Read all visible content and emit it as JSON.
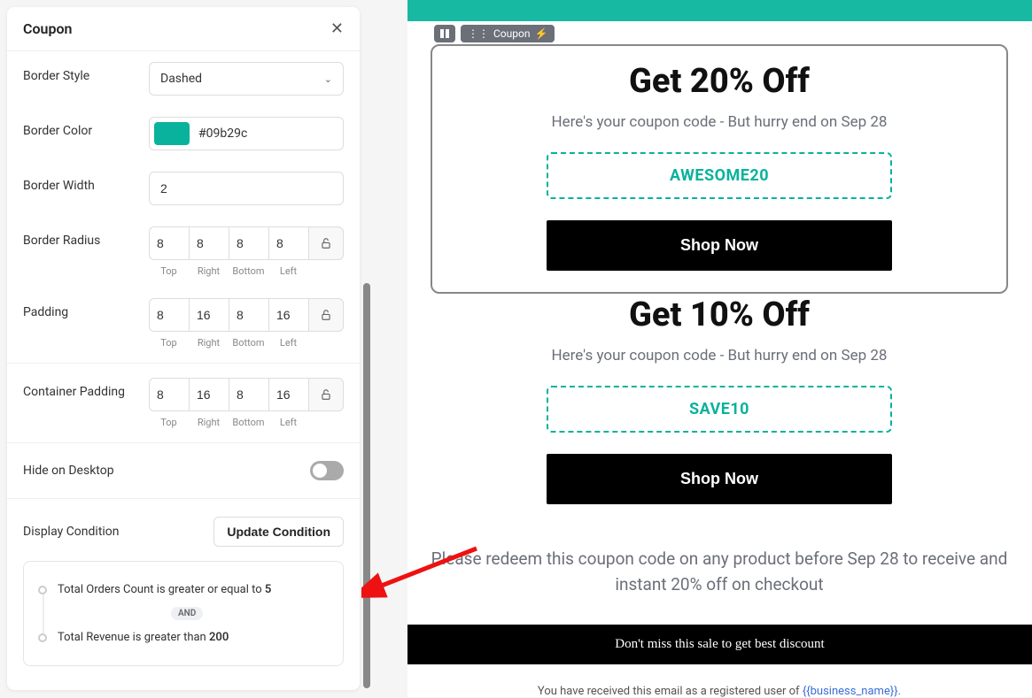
{
  "panel": {
    "title": "Coupon",
    "border_style": {
      "label": "Border Style",
      "value": "Dashed"
    },
    "border_color": {
      "label": "Border Color",
      "value": "#09b29c"
    },
    "border_width": {
      "label": "Border Width",
      "value": "2"
    },
    "border_radius": {
      "label": "Border Radius",
      "top": "8",
      "right": "8",
      "bottom": "8",
      "left": "8"
    },
    "padding": {
      "label": "Padding",
      "top": "8",
      "right": "16",
      "bottom": "8",
      "left": "16"
    },
    "container_padding": {
      "label": "Container Padding",
      "top": "8",
      "right": "16",
      "bottom": "8",
      "left": "16"
    },
    "sublabels": {
      "top": "Top",
      "right": "Right",
      "bottom": "Bottom",
      "left": "Left"
    },
    "hide_desktop": "Hide on Desktop",
    "display_condition": {
      "label": "Display Condition",
      "button": "Update Condition"
    },
    "conditions": {
      "line1_prefix": "Total Orders Count is greater or equal to ",
      "line1_value": "5",
      "join": "AND",
      "line2_prefix": "Total Revenue is greater than ",
      "line2_value": "200"
    }
  },
  "preview": {
    "element_label": "Coupon",
    "offer1": {
      "title": "Get 20% Off",
      "sub": "Here's your coupon code - But hurry end on Sep 28",
      "code": "AWESOME20",
      "button": "Shop Now"
    },
    "offer2": {
      "title": "Get 10% Off",
      "sub": "Here's your coupon code - But hurry end on Sep 28",
      "code": "SAVE10",
      "button": "Shop Now"
    },
    "redeem": "Please redeem this coupon code on any product before Sep 28 to receive and instant 20% off on checkout",
    "black_bar": "Don't miss this sale to get best discount",
    "footer_prefix": "You have received this email as a registered user of ",
    "footer_tpl": "{{business_name}}.",
    "footer_suffix": ""
  }
}
